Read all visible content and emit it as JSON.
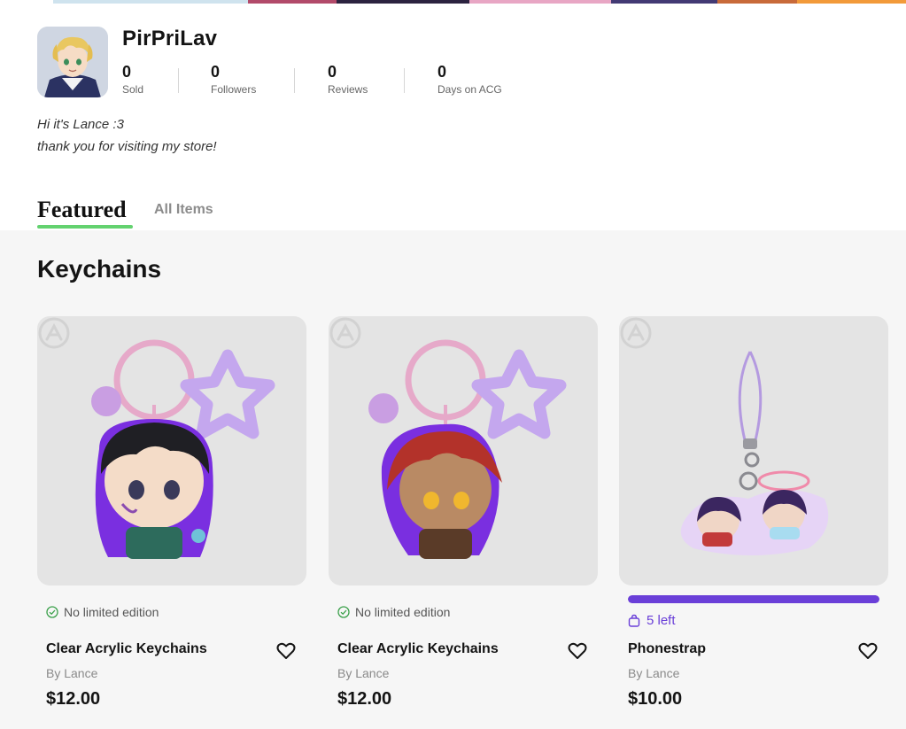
{
  "store": {
    "name": "PirPriLav",
    "bio_line_1": "Hi it's Lance :3",
    "bio_line_2": "thank you for visiting my store!",
    "stats": [
      {
        "value": "0",
        "label": "Sold"
      },
      {
        "value": "0",
        "label": "Followers"
      },
      {
        "value": "0",
        "label": "Reviews"
      },
      {
        "value": "0",
        "label": "Days on ACG"
      }
    ]
  },
  "tabs": {
    "featured": "Featured",
    "all_items": "All Items"
  },
  "section": {
    "title": "Keychains"
  },
  "products": [
    {
      "edition": "No limited edition",
      "title": "Clear Acrylic Keychains",
      "by": "By Lance",
      "price": "$12.00"
    },
    {
      "edition": "No limited edition",
      "title": "Clear Acrylic Keychains",
      "by": "By Lance",
      "price": "$12.00"
    },
    {
      "stock": "5 left",
      "stock_fraction": 1.0,
      "title": "Phonestrap",
      "by": "By Lance",
      "price": "$10.00"
    }
  ],
  "colors": {
    "accent_green": "#63d26f",
    "accent_purple": "#6a3fd8",
    "section_background": "#f6f6f6",
    "card_image_background": "#e4e4e4"
  },
  "icons": [
    "check-circle-icon",
    "heart-icon",
    "shopping-bag-icon",
    "brand-watermark-icon"
  ]
}
